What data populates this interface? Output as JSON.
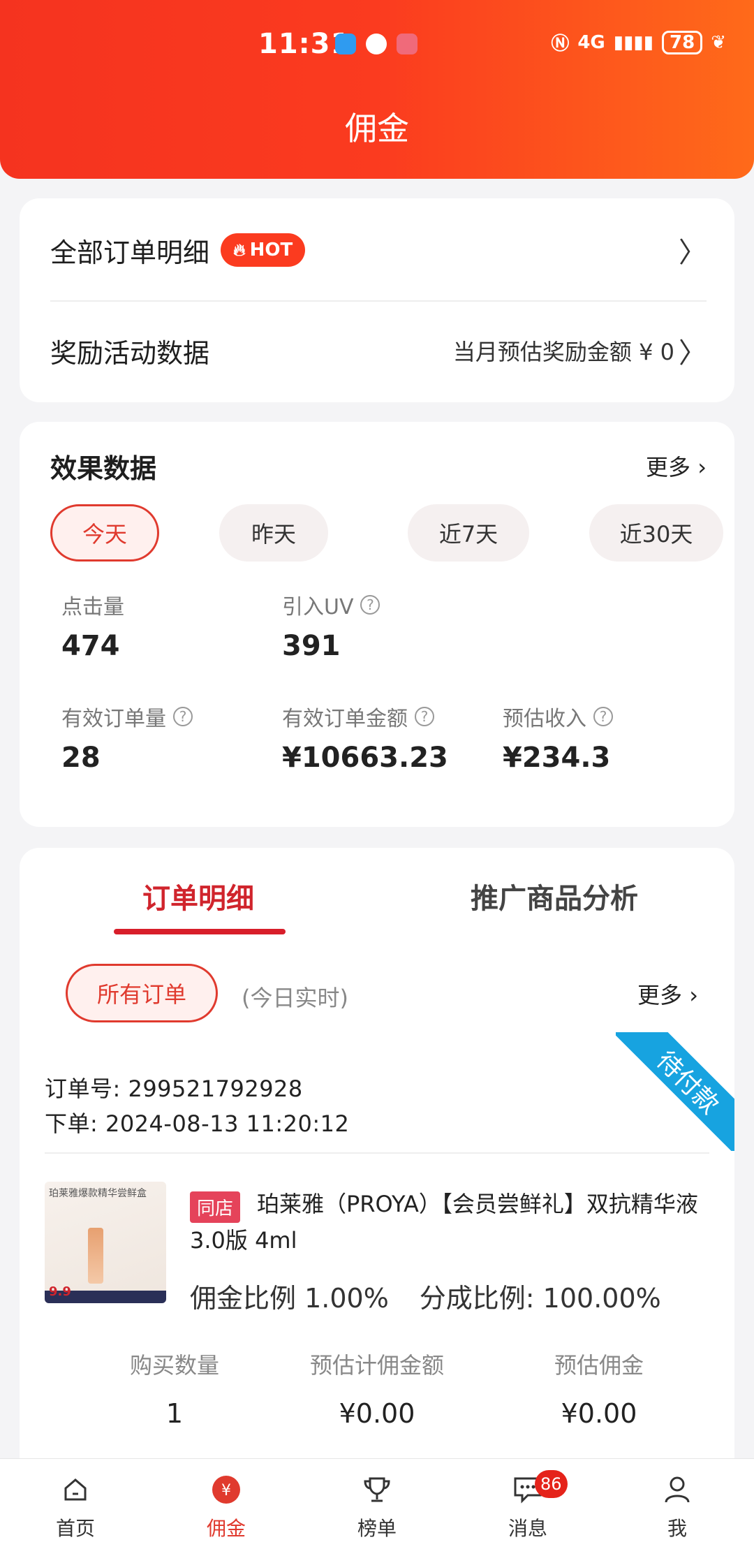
{
  "status_bar": {
    "time": "11:31",
    "network": "4G",
    "battery": "78"
  },
  "header": {
    "title": "佣金"
  },
  "orders_card": {
    "all_orders_label": "全部订单明细",
    "hot_badge": "HOT",
    "reward_label": "奖励活动数据",
    "reward_value": "当月预估奖励金额 ¥ 0"
  },
  "effect": {
    "title": "效果数据",
    "more": "更多",
    "ranges": [
      {
        "label": "今天",
        "active": true
      },
      {
        "label": "昨天",
        "active": false
      },
      {
        "label": "近7天",
        "active": false
      },
      {
        "label": "近30天",
        "active": false
      }
    ],
    "metrics": [
      {
        "label": "点击量",
        "value": "474"
      },
      {
        "label": "引入UV",
        "value": "391"
      },
      {
        "label": "有效订单量",
        "value": "28"
      },
      {
        "label": "有效订单金额",
        "value": "¥10663.23"
      },
      {
        "label": "预估收入",
        "value": "¥234.3"
      }
    ]
  },
  "orders": {
    "tabs": [
      {
        "label": "订单明细",
        "active": true
      },
      {
        "label": "推广商品分析",
        "active": false
      }
    ],
    "filter_label": "所有订单",
    "filter_hint": "(今日实时)",
    "more": "更多",
    "order": {
      "number_line": "订单号: 299521792928",
      "date_line": "下单: 2024-08-13 11:20:12",
      "status": "待付款",
      "tag": "同店",
      "product_title": "珀莱雅（PROYA）【会员尝鲜礼】双抗精华液3.0版 4ml",
      "commission_rate": "佣金比例 1.00%",
      "share_rate": "分成比例: 100.00%",
      "stats": [
        {
          "label": "购买数量",
          "value": "1"
        },
        {
          "label": "预估计佣金额",
          "value": "¥0.00"
        },
        {
          "label": "预估佣金",
          "value": "¥0.00"
        }
      ],
      "thumb_text": "珀莱雅爆款精华尝鲜盒",
      "thumb_price": "9.9"
    }
  },
  "bottom_nav": [
    {
      "label": "首页",
      "icon": "home-icon",
      "active": false
    },
    {
      "label": "佣金",
      "icon": "yen-icon",
      "active": true
    },
    {
      "label": "榜单",
      "icon": "trophy-icon",
      "active": false
    },
    {
      "label": "消息",
      "icon": "message-icon",
      "active": false,
      "badge": "86"
    },
    {
      "label": "我",
      "icon": "user-icon",
      "active": false
    }
  ],
  "colors": {
    "brand_red": "#fb3b1f",
    "active_red": "#e03a2e",
    "ribbon_blue": "#17a3e0"
  }
}
